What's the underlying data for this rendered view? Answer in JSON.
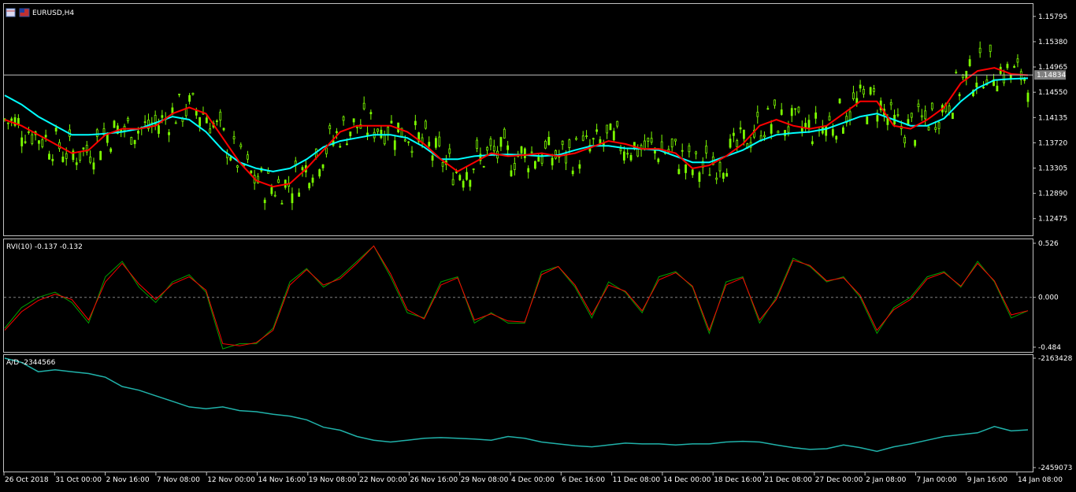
{
  "window": {
    "symbol_title": "EURUSD,H4",
    "icons": [
      "chart-window-icon",
      "flag-icon"
    ]
  },
  "colors": {
    "background": "#000000",
    "candle": "#7CFC00",
    "ma_fast": "#FF0000",
    "ma_slow": "#00FFFF",
    "rvi_main": "#00A000",
    "rvi_signal": "#FF0000",
    "ad_line": "#20B2AA",
    "axis": "#C0C0C0",
    "bid_line": "#C0C0C0"
  },
  "price_panel": {
    "ticks": [
      "1.15795",
      "1.15380",
      "1.14965",
      "1.14550",
      "1.14135",
      "1.13720",
      "1.13305",
      "1.12890",
      "1.12475"
    ],
    "current_price": "1.14834"
  },
  "rvi_panel": {
    "label": "RVI(10) -0.137 -0.132",
    "ticks": [
      "0.526",
      "0.000",
      "-0.484"
    ]
  },
  "ad_panel": {
    "label": "A/D -2344566",
    "ticks": [
      "-2163428",
      "-2459073"
    ]
  },
  "time_axis": {
    "labels": [
      "26 Oct 2018",
      "31 Oct 00:00",
      "2 Nov 16:00",
      "7 Nov 08:00",
      "12 Nov 00:00",
      "14 Nov 16:00",
      "19 Nov 08:00",
      "22 Nov 00:00",
      "26 Nov 16:00",
      "29 Nov 08:00",
      "4 Dec 00:00",
      "6 Dec 16:00",
      "11 Dec 08:00",
      "14 Dec 00:00",
      "18 Dec 16:00",
      "21 Dec 08:00",
      "27 Dec 00:00",
      "2 Jan 08:00",
      "7 Jan 00:00",
      "9 Jan 16:00",
      "14 Jan 08:00"
    ]
  },
  "chart_data": [
    {
      "type": "line",
      "ylim": [
        1.122,
        1.16
      ],
      "ma_fast": [
        1.141,
        1.14,
        1.1385,
        1.137,
        1.1355,
        1.136,
        1.1385,
        1.1395,
        1.1395,
        1.14,
        1.142,
        1.143,
        1.142,
        1.138,
        1.134,
        1.131,
        1.13,
        1.1305,
        1.133,
        1.136,
        1.139,
        1.14,
        1.14,
        1.14,
        1.139,
        1.137,
        1.1345,
        1.1325,
        1.134,
        1.1355,
        1.135,
        1.1352,
        1.1355,
        1.135,
        1.1355,
        1.1365,
        1.1375,
        1.137,
        1.1362,
        1.1362,
        1.1355,
        1.133,
        1.1335,
        1.135,
        1.137,
        1.14,
        1.141,
        1.14,
        1.1395,
        1.14,
        1.142,
        1.144,
        1.144,
        1.14,
        1.1395,
        1.141,
        1.143,
        1.147,
        1.149,
        1.1495,
        1.1485,
        1.1483
      ],
      "ma_slow": [
        1.145,
        1.1435,
        1.1415,
        1.14,
        1.1385,
        1.1385,
        1.1387,
        1.139,
        1.1395,
        1.1405,
        1.1415,
        1.141,
        1.139,
        1.136,
        1.134,
        1.133,
        1.1325,
        1.133,
        1.1345,
        1.1365,
        1.1375,
        1.138,
        1.1385,
        1.1385,
        1.138,
        1.1365,
        1.1345,
        1.1345,
        1.135,
        1.1352,
        1.1353,
        1.1352,
        1.135,
        1.1352,
        1.136,
        1.1367,
        1.1367,
        1.1363,
        1.1362,
        1.136,
        1.135,
        1.134,
        1.134,
        1.135,
        1.136,
        1.1375,
        1.1385,
        1.1388,
        1.139,
        1.1395,
        1.1405,
        1.1415,
        1.142,
        1.141,
        1.14,
        1.14,
        1.1412,
        1.144,
        1.1462,
        1.1475,
        1.1477,
        1.1478
      ]
    },
    {
      "type": "line",
      "ylim": [
        -0.484,
        0.526
      ],
      "series": [
        {
          "values": [
            -0.3,
            -0.1,
            0.0,
            0.05,
            -0.05,
            -0.25,
            0.2,
            0.35,
            0.1,
            -0.05,
            0.15,
            0.22,
            0.05,
            -0.5,
            -0.45,
            -0.45,
            -0.3,
            0.15,
            0.28,
            0.1,
            0.2,
            0.35,
            0.5,
            0.2,
            -0.15,
            -0.2,
            0.15,
            0.2,
            -0.25,
            -0.15,
            -0.25,
            -0.25,
            0.25,
            0.3,
            0.1,
            -0.2,
            0.15,
            0.05,
            -0.15,
            0.2,
            0.25,
            0.1,
            -0.35,
            0.15,
            0.2,
            -0.25,
            0.0,
            0.38,
            0.3,
            0.15,
            0.2,
            0.0,
            -0.35,
            -0.1,
            0.0,
            0.2,
            0.25,
            0.1,
            0.35,
            0.15,
            -0.2,
            -0.13
          ]
        },
        {
          "values": [
            -0.32,
            -0.14,
            -0.03,
            0.03,
            -0.02,
            -0.22,
            0.15,
            0.33,
            0.13,
            -0.02,
            0.13,
            0.2,
            0.07,
            -0.45,
            -0.47,
            -0.44,
            -0.32,
            0.12,
            0.27,
            0.12,
            0.18,
            0.33,
            0.5,
            0.23,
            -0.12,
            -0.21,
            0.12,
            0.19,
            -0.22,
            -0.16,
            -0.23,
            -0.24,
            0.22,
            0.3,
            0.12,
            -0.17,
            0.12,
            0.06,
            -0.13,
            0.17,
            0.24,
            0.11,
            -0.32,
            0.12,
            0.19,
            -0.22,
            -0.02,
            0.36,
            0.31,
            0.16,
            0.19,
            0.02,
            -0.32,
            -0.12,
            -0.02,
            0.18,
            0.24,
            0.11,
            0.33,
            0.16,
            -0.17,
            -0.13
          ]
        }
      ]
    },
    {
      "type": "line",
      "ylim": [
        -2459073,
        -2163428
      ],
      "values": [
        -2160000,
        -2175000,
        -2200000,
        -2195000,
        -2200000,
        -2205000,
        -2215000,
        -2240000,
        -2250000,
        -2265000,
        -2280000,
        -2295000,
        -2300000,
        -2295000,
        -2305000,
        -2308000,
        -2315000,
        -2320000,
        -2330000,
        -2350000,
        -2358000,
        -2375000,
        -2385000,
        -2390000,
        -2385000,
        -2380000,
        -2378000,
        -2380000,
        -2382000,
        -2385000,
        -2375000,
        -2380000,
        -2390000,
        -2395000,
        -2400000,
        -2403000,
        -2398000,
        -2393000,
        -2395000,
        -2395000,
        -2398000,
        -2395000,
        -2395000,
        -2390000,
        -2388000,
        -2390000,
        -2398000,
        -2405000,
        -2410000,
        -2408000,
        -2398000,
        -2405000,
        -2415000,
        -2403000,
        -2395000,
        -2385000,
        -2375000,
        -2370000,
        -2365000,
        -2348000,
        -2360000,
        -2357000
      ]
    }
  ]
}
